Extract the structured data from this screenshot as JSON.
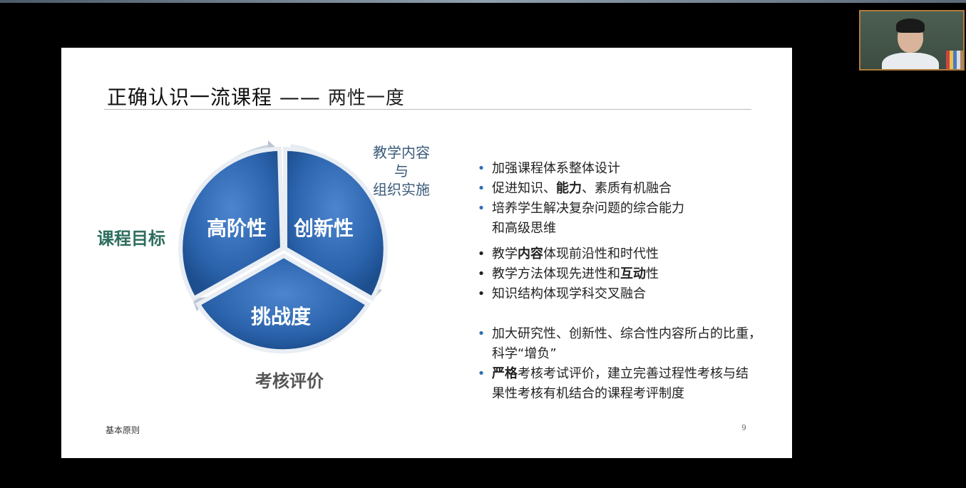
{
  "slide": {
    "title_main": "正确认识一流课程 ——",
    "title_sub": "两性一度",
    "footer_left": "基本原则",
    "page_number": "9"
  },
  "diagram": {
    "segments": [
      "高阶性",
      "创新性",
      "挑战度"
    ],
    "labels": {
      "goal": "课程目标",
      "content_line1": "教学内容",
      "content_line2": "与",
      "content_line3": "组织实施",
      "evaluation": "考核评价"
    },
    "colors": {
      "segment": "#2b63ac",
      "segment_dark": "#1d4f8f",
      "ring": "#c8d2dc"
    }
  },
  "bullets": {
    "group1": [
      {
        "text": "加强课程体系整体设计"
      },
      {
        "pre": "促进知识、",
        "bold": "能力",
        "post": "、素质有机融合"
      },
      {
        "text": "培养学生解决复杂问题的综合能力",
        "cont": "和高级思维"
      }
    ],
    "group2": [
      {
        "pre": "教学",
        "bold": "内容",
        "post": "体现前沿性和时代性"
      },
      {
        "pre": "教学方法体现先进性和",
        "bold": "互动",
        "post": "性"
      },
      {
        "text": "知识结构体现学科交叉融合"
      }
    ],
    "group3": [
      {
        "text": "加大研究性、创新性、综合性内容所占的比重，",
        "cont": "科学“增负”"
      },
      {
        "bold": "严格",
        "post": "考核考试评价，建立完善过程性考核与结",
        "cont": "果性考核有机结合的课程考评制度"
      }
    ]
  }
}
